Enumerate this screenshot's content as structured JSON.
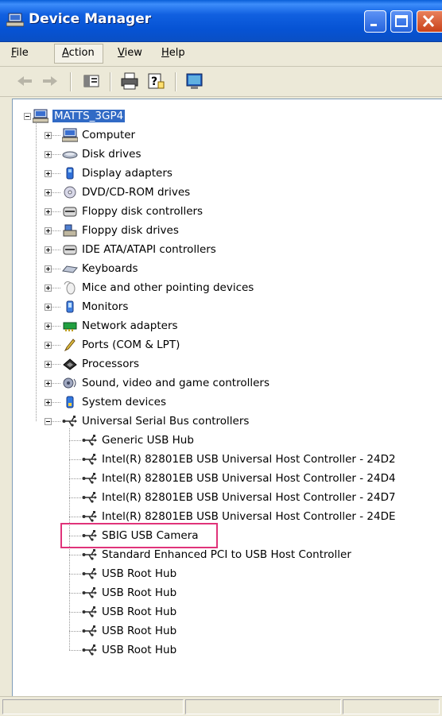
{
  "window": {
    "title": "Device Manager"
  },
  "menu": [
    {
      "label": "File",
      "accel": "F",
      "rest": "ile"
    },
    {
      "label": "Action",
      "accel": "A",
      "rest": "ction"
    },
    {
      "label": "View",
      "accel": "V",
      "rest": "iew"
    },
    {
      "label": "Help",
      "accel": "H",
      "rest": "elp"
    }
  ],
  "toolbar": {
    "buttons": [
      "back-arrow-icon",
      "forward-arrow-icon",
      "properties-pane-icon",
      "print-icon",
      "help-icon",
      "scan-hardware-icon"
    ]
  },
  "tree": {
    "root": {
      "label": "MATTS_3GP4",
      "icon": "computer-icon"
    },
    "categories": [
      {
        "label": "Computer",
        "icon": "computer-icon"
      },
      {
        "label": "Disk drives",
        "icon": "disk-drive-icon"
      },
      {
        "label": "Display adapters",
        "icon": "display-adapter-icon"
      },
      {
        "label": "DVD/CD-ROM drives",
        "icon": "cdrom-icon"
      },
      {
        "label": "Floppy disk controllers",
        "icon": "controller-icon"
      },
      {
        "label": "Floppy disk drives",
        "icon": "floppy-icon"
      },
      {
        "label": "IDE ATA/ATAPI controllers",
        "icon": "controller-icon"
      },
      {
        "label": "Keyboards",
        "icon": "keyboard-icon"
      },
      {
        "label": "Mice and other pointing devices",
        "icon": "mouse-icon"
      },
      {
        "label": "Monitors",
        "icon": "monitor-icon"
      },
      {
        "label": "Network adapters",
        "icon": "network-icon"
      },
      {
        "label": "Ports (COM & LPT)",
        "icon": "port-icon"
      },
      {
        "label": "Processors",
        "icon": "processor-icon"
      },
      {
        "label": "Sound, video and game controllers",
        "icon": "sound-icon"
      },
      {
        "label": "System devices",
        "icon": "system-icon"
      }
    ],
    "usb": {
      "label": "Universal Serial Bus controllers",
      "icon": "usb-icon",
      "children": [
        "Generic USB Hub",
        "Intel(R) 82801EB USB Universal Host Controller - 24D2",
        "Intel(R) 82801EB USB Universal Host Controller - 24D4",
        "Intel(R) 82801EB USB Universal Host Controller - 24D7",
        "Intel(R) 82801EB USB Universal Host Controller - 24DE",
        "SBIG USB Camera",
        "Standard Enhanced PCI to USB Host Controller",
        "USB Root Hub",
        "USB Root Hub",
        "USB Root Hub",
        "USB Root Hub",
        "USB Root Hub"
      ],
      "highlighted": "SBIG USB Camera"
    }
  },
  "colors": {
    "titlebar": "#0a5fd8",
    "selection": "#316ac5",
    "highlight_box": "#e0337a"
  }
}
